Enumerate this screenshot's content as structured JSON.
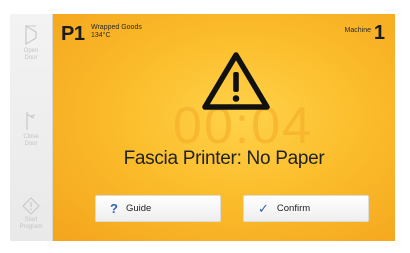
{
  "sidebar": {
    "items": [
      {
        "label_line1": "Open",
        "label_line2": "Door",
        "icon": "open-door-icon"
      },
      {
        "label_line1": "Close",
        "label_line2": "Door",
        "icon": "close-door-icon"
      },
      {
        "label_line1": "Start",
        "label_line2": "Program",
        "icon": "start-program-icon"
      }
    ]
  },
  "header": {
    "program_id": "P1",
    "program_name": "Wrapped Goods",
    "program_temp": "134°C",
    "machine_label": "Machine",
    "machine_number": "1"
  },
  "main": {
    "timer": "00:04",
    "alert_icon": "warning-icon",
    "message": "Fascia Printer: No Paper"
  },
  "buttons": {
    "guide": {
      "icon": "?",
      "label": "Guide"
    },
    "confirm": {
      "icon": "✓",
      "label": "Confirm"
    }
  },
  "colors": {
    "background": "#f3a31a",
    "accent_blue": "#2d63b8",
    "sidebar": "#eeeeee"
  }
}
